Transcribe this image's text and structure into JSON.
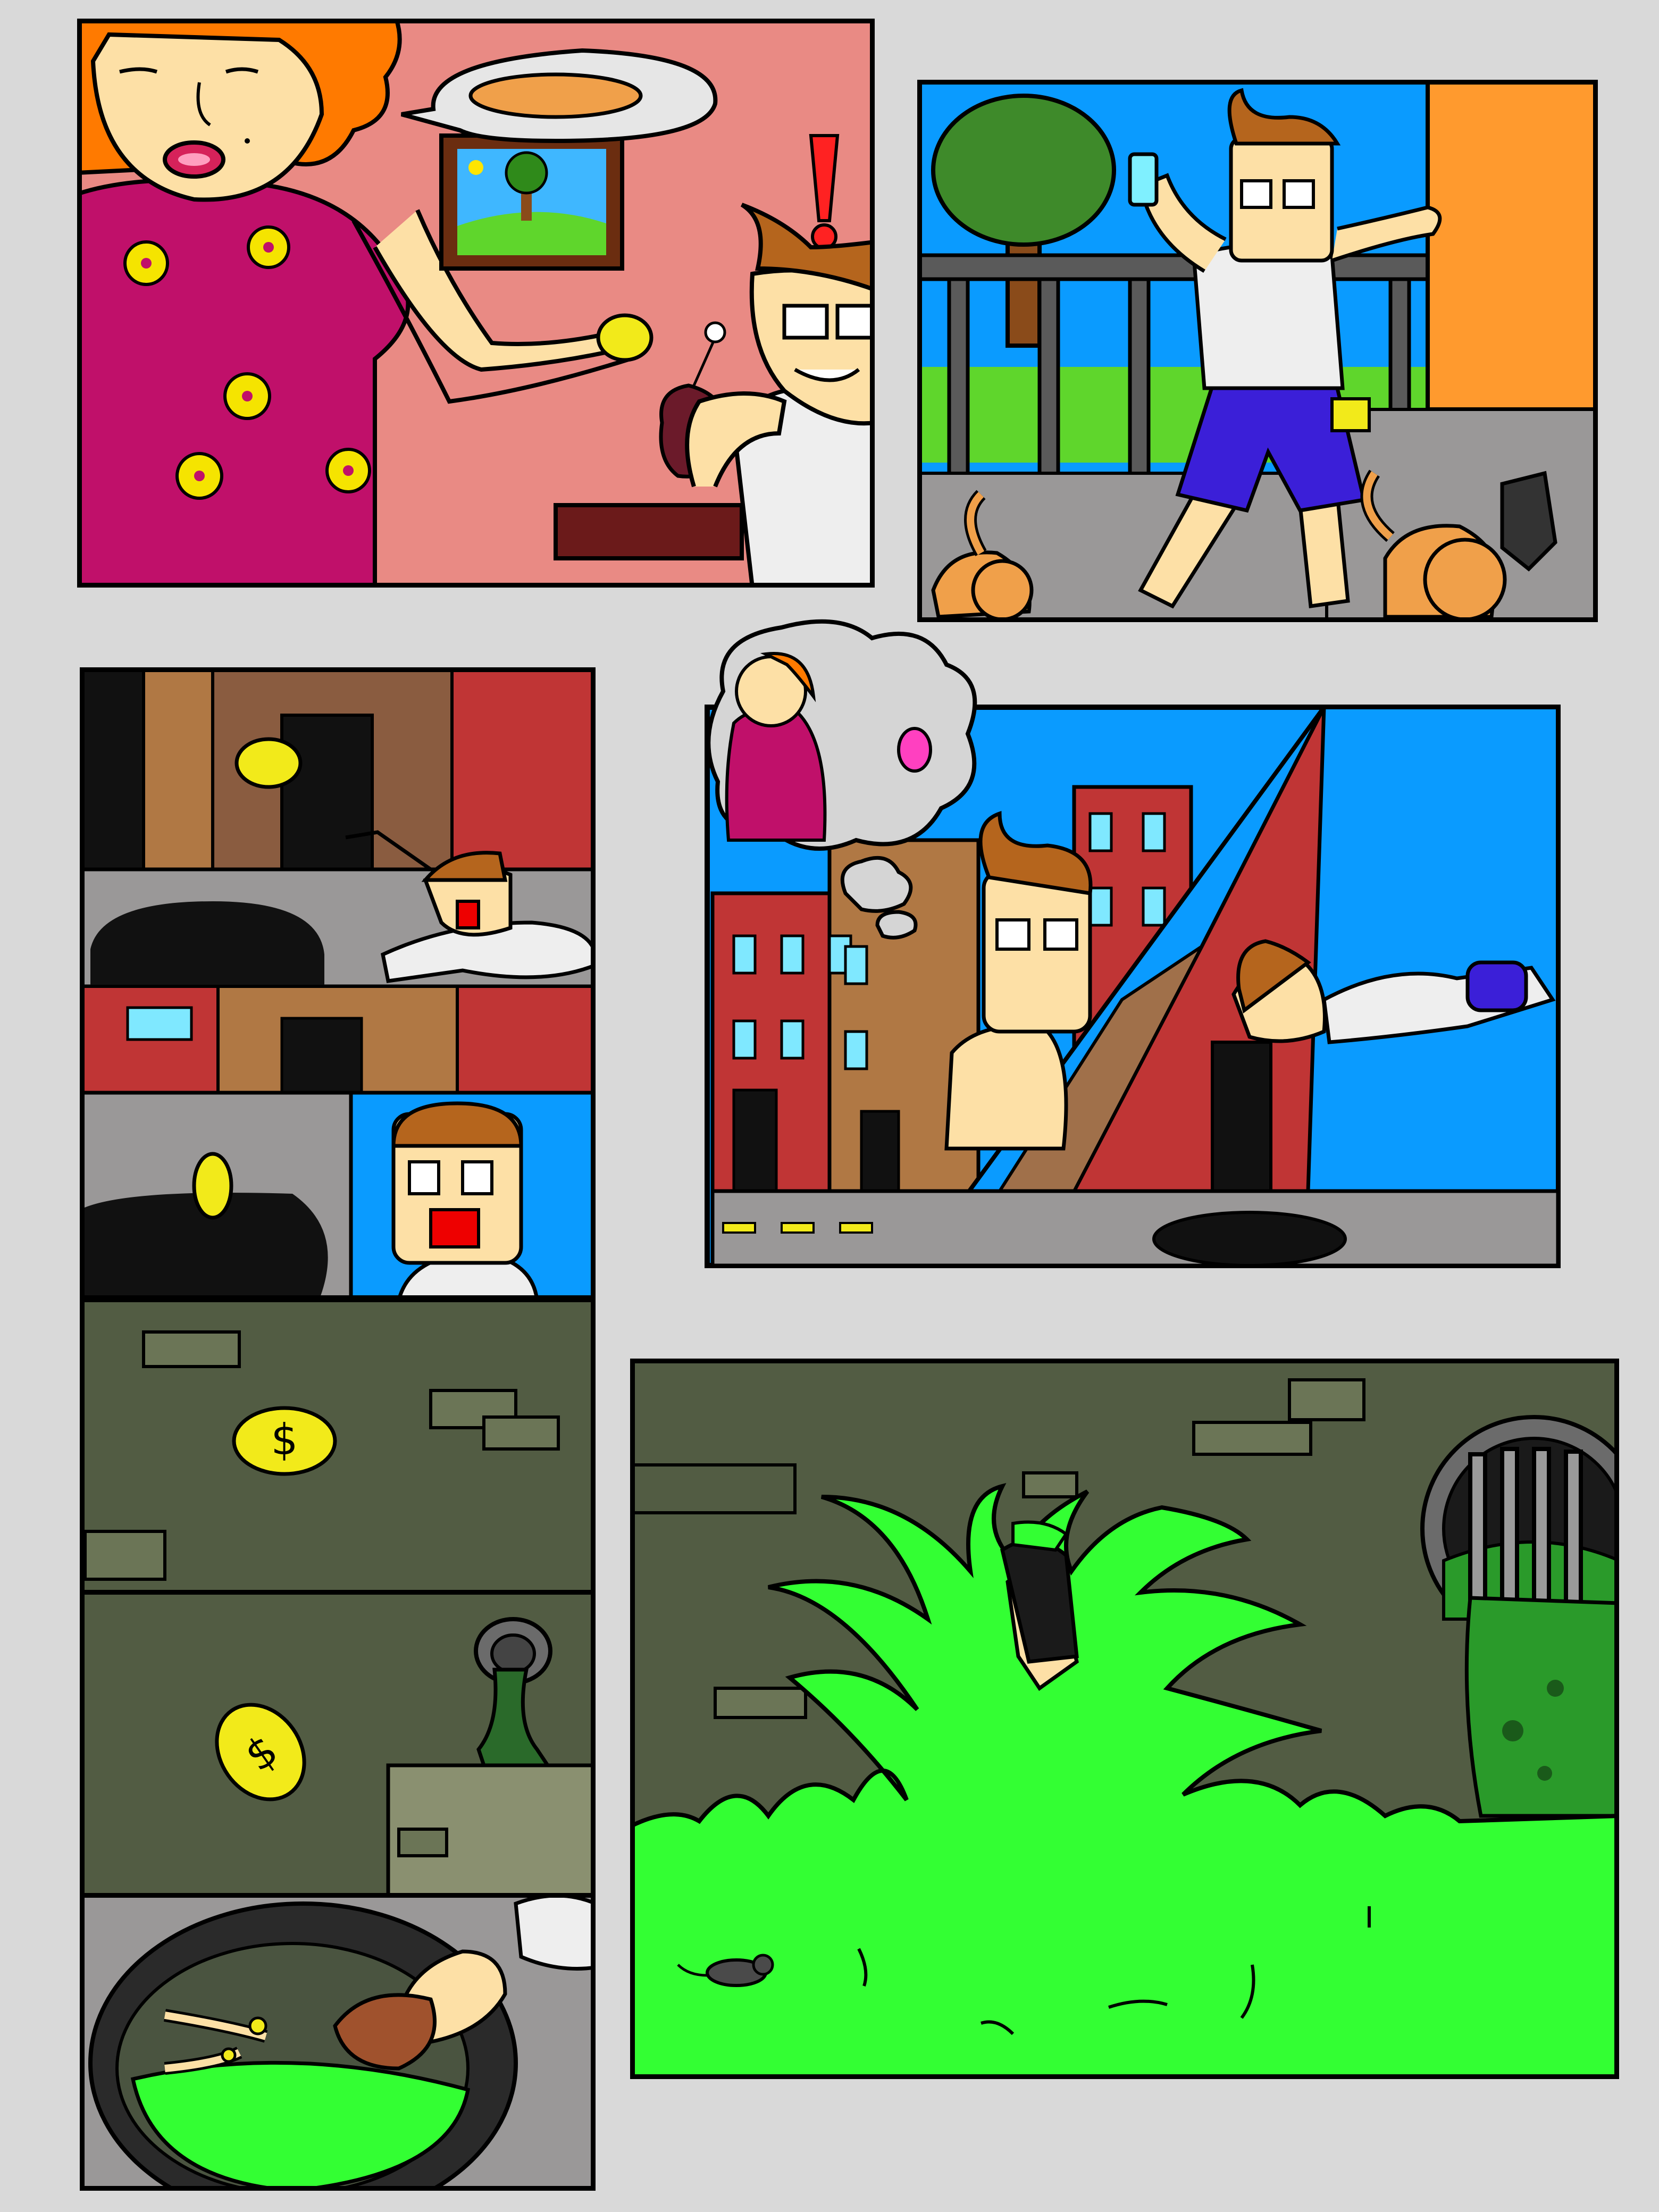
{
  "page": {
    "background": "#d9d9d9",
    "ink": "#000000"
  },
  "palette": {
    "skin": "#fde0a6",
    "hair_brown": "#b5651d",
    "hair_orange": "#ff7a00",
    "dress_magenta": "#c0106a",
    "flower_yellow": "#f5e400",
    "wall_pink": "#e98a84",
    "sky_blue": "#0a9bff",
    "grass_green": "#5fd62c",
    "slime_green": "#33ff33",
    "sewer_wall": "#525c43",
    "sewer_brick": "#6b7556",
    "street_gray": "#9a9898",
    "brick_red": "#c03535",
    "brick_brown": "#b07844",
    "window_cyan": "#7fe8ff",
    "shorts_blue": "#3b1fd8",
    "cat_orange": "#f0a04a",
    "coin_yellow": "#f2ea1a"
  },
  "panels": [
    {
      "id": "kitchen",
      "icons": [
        "woman-icon",
        "bread-icon",
        "coin-icon",
        "exclamation-icon",
        "picture-frame-icon",
        "flower-vase-icon",
        "man-icon"
      ]
    },
    {
      "id": "street-walk",
      "icons": [
        "tree-icon",
        "fence-icon",
        "phone-icon",
        "man-icon",
        "cat-icon"
      ]
    },
    {
      "id": "city-thinking",
      "icons": [
        "thought-bubble-icon",
        "woman-icon",
        "buildings-icon",
        "man-icon"
      ]
    },
    {
      "id": "coin-drop",
      "icons": [
        "coin-icon",
        "car-icon",
        "man-icon"
      ]
    },
    {
      "id": "sewer-coin-fall",
      "icons": [
        "coin-icon",
        "brick-icon"
      ]
    },
    {
      "id": "sewer-pipe",
      "icons": [
        "coin-icon",
        "pipe-icon"
      ]
    },
    {
      "id": "manhole-reach",
      "icons": [
        "manhole-icon",
        "hand-icon",
        "coin-icon"
      ]
    },
    {
      "id": "slime-splash",
      "icons": [
        "splash-icon",
        "legs-icon",
        "grate-icon",
        "rat-icon"
      ]
    }
  ]
}
